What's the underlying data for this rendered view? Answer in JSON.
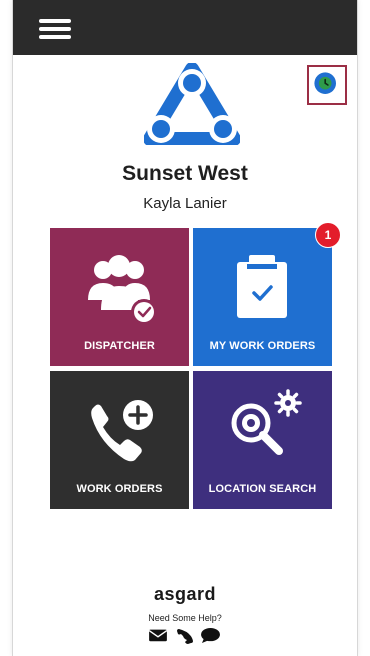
{
  "header": {
    "menu_icon": "hamburger-icon"
  },
  "logo": {
    "icon": "triangle-circles-logo",
    "color": "#1f6fd0"
  },
  "status_button": {
    "icon": "clock-icon",
    "color": "#2e9b4a",
    "ring": "#1f6fd0",
    "border": "#9b2e45"
  },
  "org": {
    "name": "Sunset West"
  },
  "user": {
    "name": "Kayla Lanier"
  },
  "tiles": [
    {
      "label": "DISPATCHER",
      "icon": "users-check-icon",
      "color": "#8f2b56"
    },
    {
      "label": "MY WORK ORDERS",
      "icon": "clipboard-check-icon",
      "color": "#1f6fd0",
      "badge": "1"
    },
    {
      "label": "WORK ORDERS",
      "icon": "phone-plus-icon",
      "color": "#2f2f2f"
    },
    {
      "label": "LOCATION SEARCH",
      "icon": "search-gears-icon",
      "color": "#3e2f7e"
    }
  ],
  "footer": {
    "brand": "asgard",
    "help_text": "Need Some Help?",
    "icons": [
      "envelope-icon",
      "phone-icon",
      "chat-icon"
    ]
  }
}
